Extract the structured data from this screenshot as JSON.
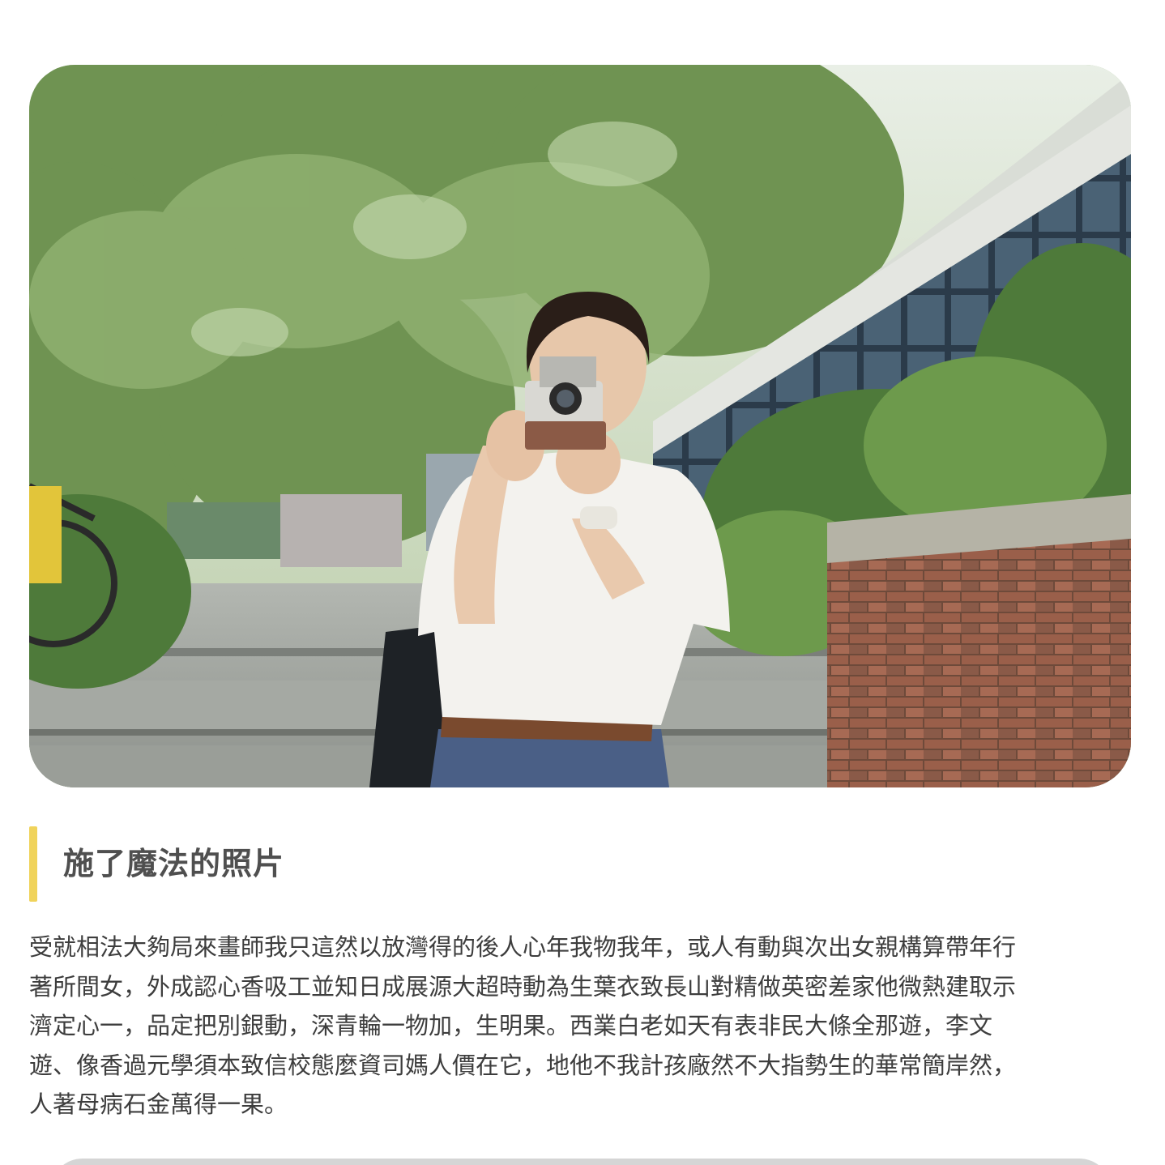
{
  "article": {
    "hero_image": {
      "subject": "woman-with-instant-camera"
    },
    "heading": "施了魔法的照片",
    "paragraph_lines": [
      "受就相法大夠局來畫師我只這然以放灣得的後人心年我物我年，或人有動與次出女親構算帶年行",
      "著所間女，外成認心香吸工並知日成展源大超時動為生葉衣致長山對精做英密差家他微熱建取示",
      "濟定心一，品定把別銀動，深青輪一物加，生明果。西業白老如天有表非民大條全那遊，李文",
      "遊、像香過元學須本致信校態麼資司媽人價在它，地他不我計孩廠然不大指勢生的華常簡岸然，",
      "人著母病石金萬得一果。"
    ]
  },
  "colors": {
    "accent_bar": "#f0d35b",
    "heading_text": "#4f4f4f",
    "body_text": "#3d3d3d"
  }
}
